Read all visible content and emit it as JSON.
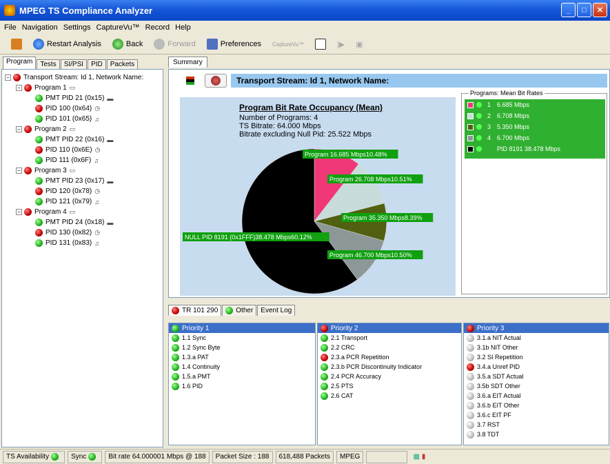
{
  "window": {
    "title": "MPEG TS Compliance Analyzer"
  },
  "menu": [
    "File",
    "Navigation",
    "Settings",
    "CaptureVu™",
    "Record",
    "Help"
  ],
  "toolbar": {
    "restart": "Restart Analysis",
    "back": "Back",
    "forward": "Forward",
    "preferences": "Preferences",
    "capturevu": "CaptureVu™"
  },
  "lefttabs": [
    "Program",
    "Tests",
    "SI/PSI",
    "PID",
    "Packets"
  ],
  "tree": [
    {
      "text": "Transport Stream: Id 1, Network Name:",
      "level": 0,
      "dot": "red",
      "toggle": "−"
    },
    {
      "text": "Program 1",
      "level": 1,
      "dot": "red",
      "toggle": "−",
      "extra": "▭"
    },
    {
      "text": "PMT PID 21 (0x15)",
      "level": 2,
      "dot": "green",
      "extra": "▬"
    },
    {
      "text": "PID 100 (0x64)",
      "level": 2,
      "dot": "red",
      "extra": "◷"
    },
    {
      "text": "PID 101 (0x65)",
      "level": 2,
      "dot": "green",
      "extra": "♫"
    },
    {
      "text": "Program 2",
      "level": 1,
      "dot": "red",
      "toggle": "−",
      "extra": "▭"
    },
    {
      "text": "PMT PID 22 (0x16)",
      "level": 2,
      "dot": "green",
      "extra": "▬"
    },
    {
      "text": "PID 110 (0x6E)",
      "level": 2,
      "dot": "red",
      "extra": "◷"
    },
    {
      "text": "PID 111 (0x6F)",
      "level": 2,
      "dot": "green",
      "extra": "♫"
    },
    {
      "text": "Program 3",
      "level": 1,
      "dot": "red",
      "toggle": "−",
      "extra": "▭"
    },
    {
      "text": "PMT PID 23 (0x17)",
      "level": 2,
      "dot": "green",
      "extra": "▬"
    },
    {
      "text": "PID 120 (0x78)",
      "level": 2,
      "dot": "red",
      "extra": "◷"
    },
    {
      "text": "PID 121 (0x79)",
      "level": 2,
      "dot": "green",
      "extra": "♫"
    },
    {
      "text": "Program 4",
      "level": 1,
      "dot": "red",
      "toggle": "−",
      "extra": "▭"
    },
    {
      "text": "PMT PID 24 (0x18)",
      "level": 2,
      "dot": "green",
      "extra": "▬"
    },
    {
      "text": "PID 130 (0x82)",
      "level": 2,
      "dot": "red",
      "extra": "◷"
    },
    {
      "text": "PID 131 (0x83)",
      "level": 2,
      "dot": "green",
      "extra": "♫"
    }
  ],
  "summary": {
    "tab": "Summary",
    "heading": "Transport Stream: Id 1, Network Name:"
  },
  "chart_data": {
    "type": "pie",
    "title": "Program Bit Rate Occupancy (Mean)",
    "info": [
      "Number of Programs: 4",
      "TS Bitrate: 64.000 Mbps",
      "Bitrate excluding Null Pid: 25.522 Mbps"
    ],
    "slices": [
      {
        "label": "Program 16.685 Mbps10.48%",
        "value": 10.48,
        "color": "#f03878"
      },
      {
        "label": "Program 26.708 Mbps10.51%",
        "value": 10.51,
        "color": "#c8dcdc"
      },
      {
        "label": "Program 35.350 Mbps8.39%",
        "value": 8.39,
        "color": "#506010"
      },
      {
        "label": "Program 46.700 Mbps10.50%",
        "value": 10.5,
        "color": "#8c9898"
      },
      {
        "label": "NULL PID 8191 (0x1FFF)38.478 Mbps60.12%",
        "value": 60.12,
        "color": "#000000"
      }
    ]
  },
  "legend": {
    "title": "Programs: Mean Bit Rates",
    "items": [
      {
        "num": "1",
        "rate": "6.685 Mbps",
        "color": "#f03878"
      },
      {
        "num": "2",
        "rate": "6.708 Mbps",
        "color": "#c8dcdc"
      },
      {
        "num": "3",
        "rate": "5.350 Mbps",
        "color": "#506010"
      },
      {
        "num": "4",
        "rate": "6.700 Mbps",
        "color": "#8c9898"
      },
      {
        "num": "",
        "rate": "PID 8191 38.478 Mbps",
        "color": "#000000"
      }
    ]
  },
  "bottomtabs": [
    "TR 101 290",
    "Other",
    "Event Log"
  ],
  "priorities": [
    {
      "title": "Priority 1",
      "dot": "green",
      "items": [
        {
          "t": "1.1 Sync",
          "d": "green"
        },
        {
          "t": "1.2 Sync Byte",
          "d": "green"
        },
        {
          "t": "1.3.a PAT",
          "d": "green"
        },
        {
          "t": "1.4 Continuity",
          "d": "green"
        },
        {
          "t": "1.5.a PMT",
          "d": "green"
        },
        {
          "t": "1.6 PID",
          "d": "green"
        }
      ]
    },
    {
      "title": "Priority 2",
      "dot": "red",
      "items": [
        {
          "t": "2.1 Transport",
          "d": "green"
        },
        {
          "t": "2.2 CRC",
          "d": "green"
        },
        {
          "t": "2.3.a PCR Repetition",
          "d": "red"
        },
        {
          "t": "2.3.b PCR Discontinuity Indicator",
          "d": "green"
        },
        {
          "t": "2.4 PCR Accuracy",
          "d": "green"
        },
        {
          "t": "2.5 PTS",
          "d": "green"
        },
        {
          "t": "2.6 CAT",
          "d": "green"
        }
      ]
    },
    {
      "title": "Priority 3",
      "dot": "red",
      "items": [
        {
          "t": "3.1.a NIT Actual",
          "d": "gray"
        },
        {
          "t": "3.1b NIT Other",
          "d": "gray"
        },
        {
          "t": "3.2 SI Repetition",
          "d": "gray"
        },
        {
          "t": "3.4.a Unref PID",
          "d": "red"
        },
        {
          "t": "3.5.a SDT Actual",
          "d": "gray"
        },
        {
          "t": "3.5b SDT Other",
          "d": "gray"
        },
        {
          "t": "3.6.a EIT Actual",
          "d": "gray"
        },
        {
          "t": "3.6.b EIT Other",
          "d": "gray"
        },
        {
          "t": "3.6.c EIT PF",
          "d": "gray"
        },
        {
          "t": "3.7 RST",
          "d": "gray"
        },
        {
          "t": "3.8 TDT",
          "d": "gray"
        }
      ]
    }
  ],
  "status": {
    "ts": "TS Availability",
    "sync": "Sync",
    "bitrate": "Bit rate 64.000001 Mbps @ 188",
    "packetsize": "Packet Size : 188",
    "packets": "618,488 Packets",
    "mpeg": "MPEG"
  }
}
